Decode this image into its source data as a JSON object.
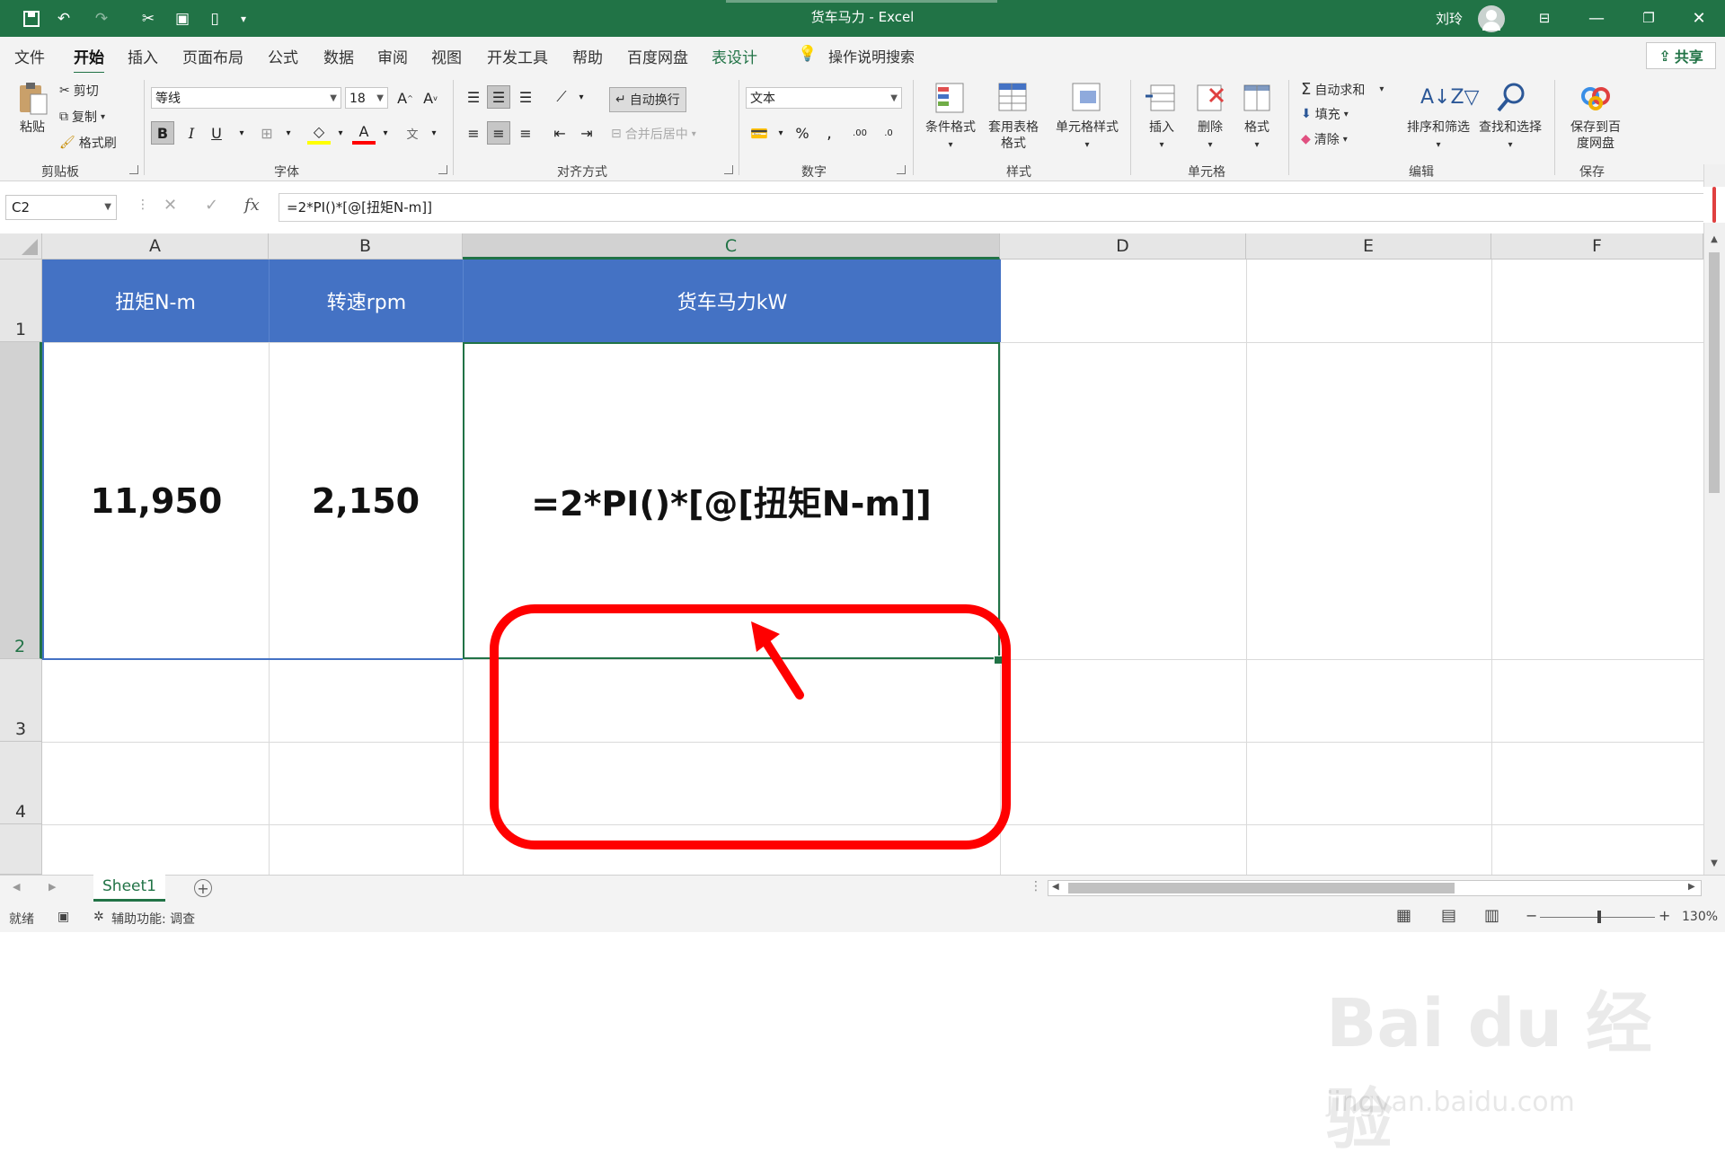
{
  "window": {
    "title": "货车马力 - Excel",
    "user": "刘玲"
  },
  "ribbon_tabs": [
    "文件",
    "开始",
    "插入",
    "页面布局",
    "公式",
    "数据",
    "审阅",
    "视图",
    "开发工具",
    "帮助",
    "百度网盘",
    "表设计"
  ],
  "ribbon_active_tab": "开始",
  "tell_me": "操作说明搜索",
  "share_label": "共享",
  "clipboard": {
    "paste": "粘贴",
    "cut": "剪切",
    "copy": "复制",
    "format_painter": "格式刷",
    "group": "剪贴板"
  },
  "font": {
    "name": "等线",
    "size": "18",
    "bold": "B",
    "italic": "I",
    "underline": "U",
    "group": "字体"
  },
  "alignment": {
    "wrap_text": "自动换行",
    "merge_center": "合并后居中",
    "group": "对齐方式"
  },
  "number": {
    "format": "文本",
    "percent": "%",
    "group": "数字"
  },
  "styles": {
    "conditional": "条件格式",
    "table_format": "套用表格格式",
    "cell_styles": "单元格样式",
    "group": "样式"
  },
  "cells": {
    "insert": "插入",
    "delete": "删除",
    "format": "格式",
    "group": "单元格"
  },
  "editing": {
    "autosum": "自动求和",
    "fill": "填充",
    "clear": "清除",
    "sort_filter": "排序和筛选",
    "find_select": "查找和选择",
    "group": "编辑"
  },
  "save_group": {
    "save_to_baidu": "保存到百度网盘",
    "group": "保存"
  },
  "formula_bar": {
    "name_box": "C2",
    "fx": "fx",
    "formula": "=2*PI()*[@[扭矩N-m]]"
  },
  "columns": [
    "A",
    "B",
    "C",
    "D",
    "E",
    "F"
  ],
  "rows": [
    "1",
    "2",
    "3",
    "4"
  ],
  "table": {
    "headers": [
      "扭矩N-m",
      "转速rpm",
      "货车马力kW"
    ],
    "row2": [
      "11,950",
      "2,150",
      "=2*PI()*[@[扭矩N-m]]"
    ]
  },
  "sheet_tab": "Sheet1",
  "status": {
    "ready": "就绪",
    "accessibility": "辅助功能: 调查",
    "zoom": "130%"
  },
  "watermark": {
    "main": "Bai du 经验",
    "sub": "jingyan.baidu.com"
  },
  "colors": {
    "excel_green": "#217346",
    "table_header": "#4472c4",
    "highlight": "#ff0000"
  }
}
